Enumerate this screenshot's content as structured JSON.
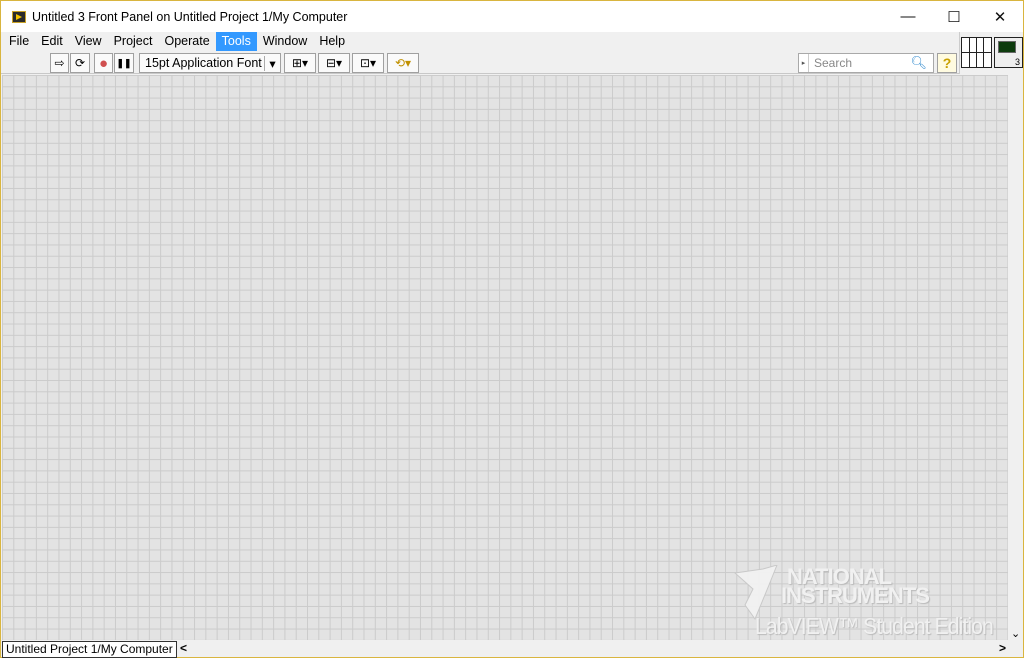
{
  "window": {
    "title": "Untitled 3 Front Panel on Untitled Project 1/My Computer",
    "minimize": "—",
    "maximize": "☐",
    "close": "✕"
  },
  "menu": [
    "File",
    "Edit",
    "View",
    "Project",
    "Operate",
    "Tools",
    "Window",
    "Help"
  ],
  "menu_active": "Tools",
  "toolbar": {
    "run": "⇨",
    "run_continuous": "⟳",
    "abort": "●",
    "pause": "❚❚",
    "font": "15pt Application Font",
    "dropdown": "▾",
    "align": "⊞▾",
    "distribute": "⊟▾",
    "resize": "⊡▾",
    "reorder": "⟲▾",
    "search_placeholder": "Search",
    "help": "?"
  },
  "connector": {
    "vi_icon_number": "3"
  },
  "status": {
    "context": "Untitled Project 1/My Computer",
    "hscroll_left": "<",
    "hscroll_right": ">",
    "vscroll_down": "⌄"
  },
  "watermark": {
    "line1": "NATIONAL",
    "line2": "INSTRUMENTS",
    "line3": "LabVIEW™ Student Edition"
  },
  "colors": {
    "accent": "#3399ff",
    "border": "#d9b53f"
  }
}
